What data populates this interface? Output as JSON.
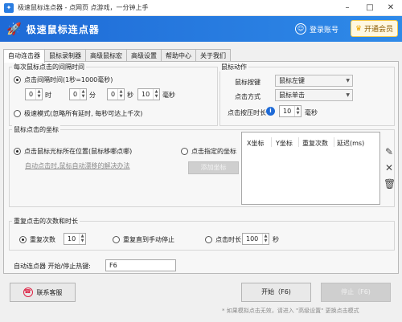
{
  "window": {
    "title": "极速鼠标连点器 - 点网页 点游戏，一分钟上手",
    "controls": {
      "minimize": "–",
      "maximize": "□",
      "close": "✕"
    }
  },
  "banner": {
    "icon": "rocket-icon",
    "app_title": "极速鼠标连点器",
    "login_label": "登录账号",
    "vip_label": "开通会员",
    "colors": {
      "banner": "#1e6ad6",
      "vip_border": "#f3c94b"
    }
  },
  "tabs": [
    {
      "label": "自动连击器",
      "active": true
    },
    {
      "label": "鼠标录制器",
      "active": false
    },
    {
      "label": "高级鼠标宏",
      "active": false
    },
    {
      "label": "高级设置",
      "active": false
    },
    {
      "label": "帮助中心",
      "active": false
    },
    {
      "label": "关于我们",
      "active": false
    }
  ],
  "interval": {
    "group_title": "每次鼠标点击的间隔时间",
    "time_radio_label": "点击间隔时间(1秒=1000毫秒)",
    "hours_value": "0",
    "hours_unit": "时",
    "minutes_value": "0",
    "minutes_unit": "分",
    "seconds_value": "0",
    "seconds_unit": "秒",
    "ms_value": "10",
    "ms_unit": "毫秒",
    "extreme_label": "极速模式(忽略所有延时, 每秒可达上千次)"
  },
  "mouse_action": {
    "group_title": "鼠标动作",
    "button_label": "鼠标按键",
    "button_value": "鼠标左键",
    "mode_label": "点击方式",
    "mode_value": "鼠标单击",
    "press_label": "点击按压时长",
    "press_value": "10",
    "press_unit": "毫秒"
  },
  "coords": {
    "group_title": "鼠标点击的坐标",
    "cursor_label": "点击鼠标光标所在位置(鼠标移哪点哪)",
    "auto_drift_link": "自动点击时,鼠标自动漂移的解决办法",
    "specified_label": "点击指定的坐标",
    "add_button": "添加坐标",
    "columns": [
      "X坐标",
      "Y坐标",
      "重复次数",
      "延迟(ms)"
    ]
  },
  "repeat": {
    "group_title": "重复点击的次数和时长",
    "count_label": "重复次数",
    "count_value": "10",
    "until_stop_label": "重复直到手动停止",
    "duration_label": "点击时长",
    "duration_value": "100",
    "duration_unit": "秒"
  },
  "hotkey": {
    "label": "自动连点器 开始/停止热键:",
    "value": "F6"
  },
  "footer": {
    "contact_label": "联系客服",
    "start_label": "开始（F6)",
    "stop_label": "停止（F6)",
    "note": "* 如果模拟点击无效，请进入 \"高级设置\" 更换点击模式"
  }
}
